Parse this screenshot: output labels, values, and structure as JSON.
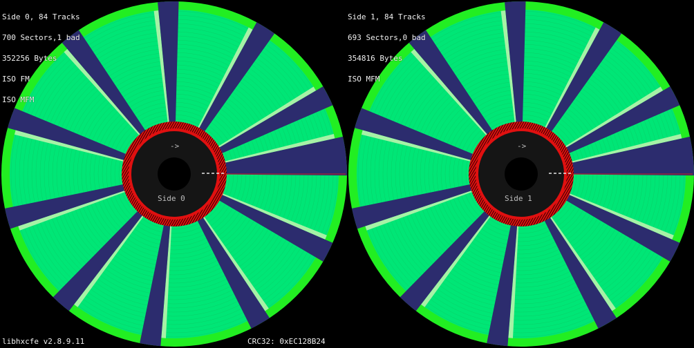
{
  "sides": [
    {
      "label": "Side 0",
      "arrow": "->",
      "info": [
        "Side 0, 84 Tracks",
        "700 Sectors,1 bad",
        "352256 Bytes",
        "ISO FM",
        "ISO MFM"
      ]
    },
    {
      "label": "Side 1",
      "arrow": "->",
      "info": [
        "Side 1, 84 Tracks",
        "693 Sectors,0 bad",
        "354816 Bytes",
        "ISO MFM"
      ]
    }
  ],
  "footer": {
    "version": "libhxcfe v2.8.9.11",
    "crc": "CRC32: 0xEC128B24"
  },
  "colors": {
    "background": "#000000",
    "good_sector": "#00e676",
    "outer_ring": "#22ee22",
    "gap": "#2c2c6e",
    "gap_edge": "#a6f2a6",
    "bad_track_ring": "#e01010",
    "hub": "#151515",
    "spindle": "#000000"
  }
}
